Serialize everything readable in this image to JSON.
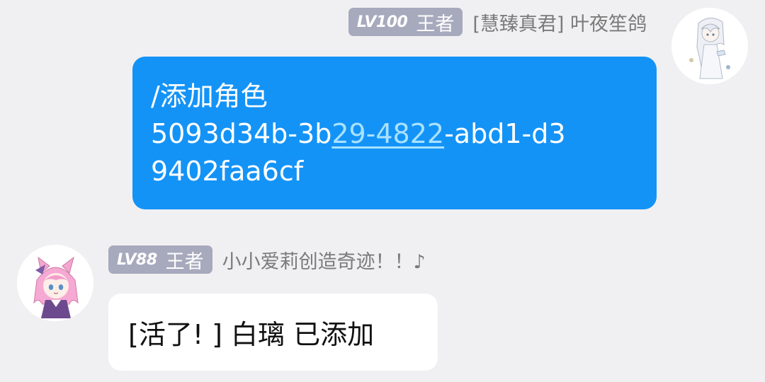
{
  "messages": [
    {
      "sender": {
        "level": "LV100",
        "title": "王者",
        "name": "[慧臻真君] 叶夜笙鸽"
      },
      "avatar_icon": "anime-girl-white-hair-avatar",
      "side": "right",
      "bubble_color": "#1493f7",
      "text_lines": [
        "/添加角色"
      ],
      "id_parts": {
        "pre": "5093d34b-3b",
        "link": "29-4822",
        "post": "-abd1-d3",
        "line3": "9402faa6cf"
      },
      "link_color": "#a8e2ff"
    },
    {
      "sender": {
        "level": "LV88",
        "title": "王者",
        "name": "小小爱莉创造奇迹！！♪"
      },
      "avatar_icon": "anime-girl-pink-hair-cat-ears-avatar",
      "side": "left",
      "bubble_color": "#ffffff",
      "text": "[活了! ] 白璃 已添加"
    }
  ],
  "colors": {
    "background": "#f0f0f2",
    "badge": "#a7a9bd",
    "sender_name": "#7a7a7a"
  }
}
